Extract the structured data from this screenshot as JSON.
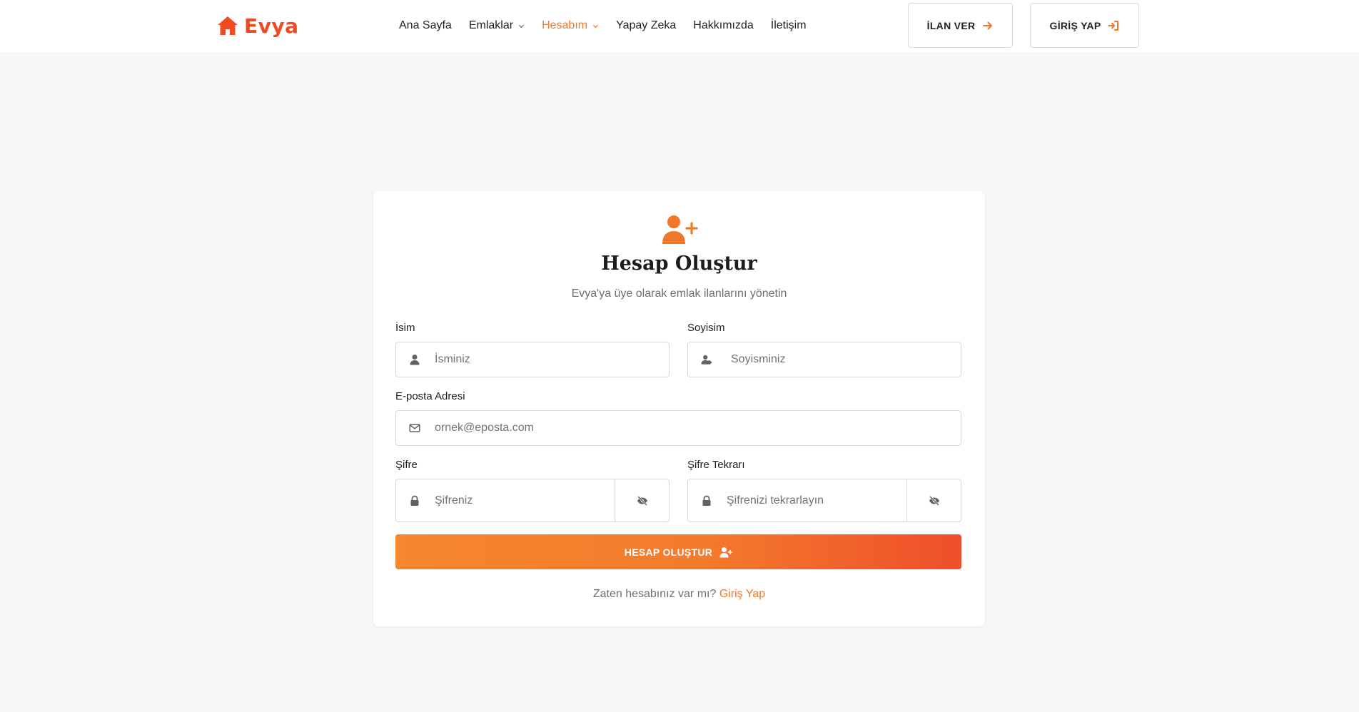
{
  "brand": {
    "name": "Evya",
    "accent": "#ef4a23",
    "orange": "#f0782a"
  },
  "nav": {
    "items": [
      {
        "label": "Ana Sayfa",
        "dropdown": false,
        "active": false
      },
      {
        "label": "Emlaklar",
        "dropdown": true,
        "active": false
      },
      {
        "label": "Hesabım",
        "dropdown": true,
        "active": true
      },
      {
        "label": "Yapay Zeka",
        "dropdown": false,
        "active": false
      },
      {
        "label": "Hakkımızda",
        "dropdown": false,
        "active": false
      },
      {
        "label": "İletişim",
        "dropdown": false,
        "active": false
      }
    ]
  },
  "header_buttons": {
    "ilan": {
      "label": "İLAN VER",
      "icon": "arrow-right-icon"
    },
    "giris": {
      "label": "GİRİŞ YAP",
      "icon": "sign-in-icon"
    }
  },
  "form": {
    "icon": "user-plus-icon",
    "title": "Hesap Oluştur",
    "subtitle": "Evya'ya üye olarak emlak ilanlarını yönetin",
    "first_name": {
      "label": "İsim",
      "placeholder": "İsminiz",
      "icon": "user-icon"
    },
    "last_name": {
      "label": "Soyisim",
      "placeholder": "Soyisminiz",
      "icon": "user-tag-icon"
    },
    "email": {
      "label": "E-posta Adresi",
      "placeholder": "ornek@eposta.com",
      "icon": "envelope-icon"
    },
    "password": {
      "label": "Şifre",
      "placeholder": "Şifreniz",
      "icon": "lock-icon",
      "toggle_icon": "eye-slash-icon"
    },
    "password_confirm": {
      "label": "Şifre Tekrarı",
      "placeholder": "Şifrenizi tekrarlayın",
      "icon": "lock-icon",
      "toggle_icon": "eye-slash-icon"
    },
    "submit_label": "HESAP OLUŞTUR",
    "login_prompt": "Zaten hesabınız var mı?",
    "login_link": "Giriş Yap"
  }
}
